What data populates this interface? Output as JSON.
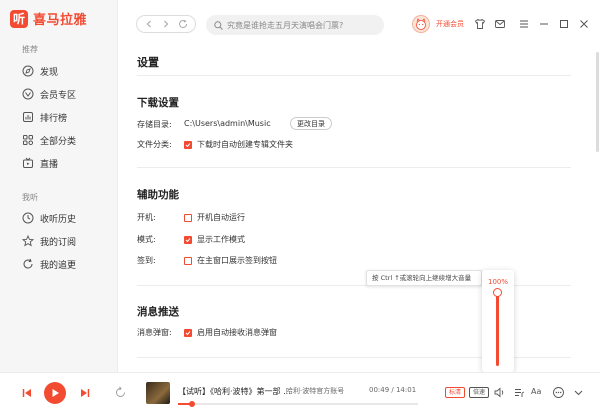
{
  "app": {
    "logo_glyph": "听",
    "name": "喜马拉雅",
    "brand_color": "#f24b32"
  },
  "sidebar": {
    "sections": [
      {
        "title": "推荐",
        "items": [
          {
            "label": "发现",
            "icon": "compass-icon"
          },
          {
            "label": "会员专区",
            "icon": "vip-icon"
          },
          {
            "label": "排行榜",
            "icon": "chart-icon"
          },
          {
            "label": "全部分类",
            "icon": "grid-icon"
          },
          {
            "label": "直播",
            "icon": "tv-icon"
          }
        ]
      },
      {
        "title": "我听",
        "items": [
          {
            "label": "收听历史",
            "icon": "clock-icon"
          },
          {
            "label": "我的订阅",
            "icon": "star-icon"
          },
          {
            "label": "我的追更",
            "icon": "refresh-icon"
          }
        ]
      }
    ]
  },
  "topbar": {
    "search_placeholder": "究竟是谁抢走五月天演唱会门票?",
    "vip_link": "开通会员"
  },
  "settings": {
    "title": "设置",
    "download": {
      "heading": "下载设置",
      "dir_label": "存储目录:",
      "dir_path": "C:\\Users\\admin\\Music",
      "change_dir_button": "更改目录",
      "category_label": "文件分类:",
      "category_option": "下载时自动创建专辑文件夹",
      "category_checked": true
    },
    "assist": {
      "heading": "辅助功能",
      "rows": [
        {
          "label": "开机:",
          "option": "开机自动运行",
          "checked": false
        },
        {
          "label": "模式:",
          "option": "显示工作模式",
          "checked": true
        },
        {
          "label": "签到:",
          "option": "在主窗口展示签到按钮",
          "checked": false
        }
      ]
    },
    "push": {
      "heading": "消息推送",
      "label": "消息弹窗:",
      "option": "启用自动接收消息弹窗",
      "checked": true
    }
  },
  "volume": {
    "tooltip": "按 Ctrl ↑或滚轮向上继续增大音量",
    "percent_label": "100%",
    "level": 1.0
  },
  "player": {
    "title": "【试听】《哈利·波特》第一部 ...",
    "artist": "哈利·波特官方账号",
    "time": "00:49 / 14:01",
    "progress": 0.058,
    "badge_quality": "标清",
    "badge_speed": "倍速",
    "font_label": "Aa"
  }
}
